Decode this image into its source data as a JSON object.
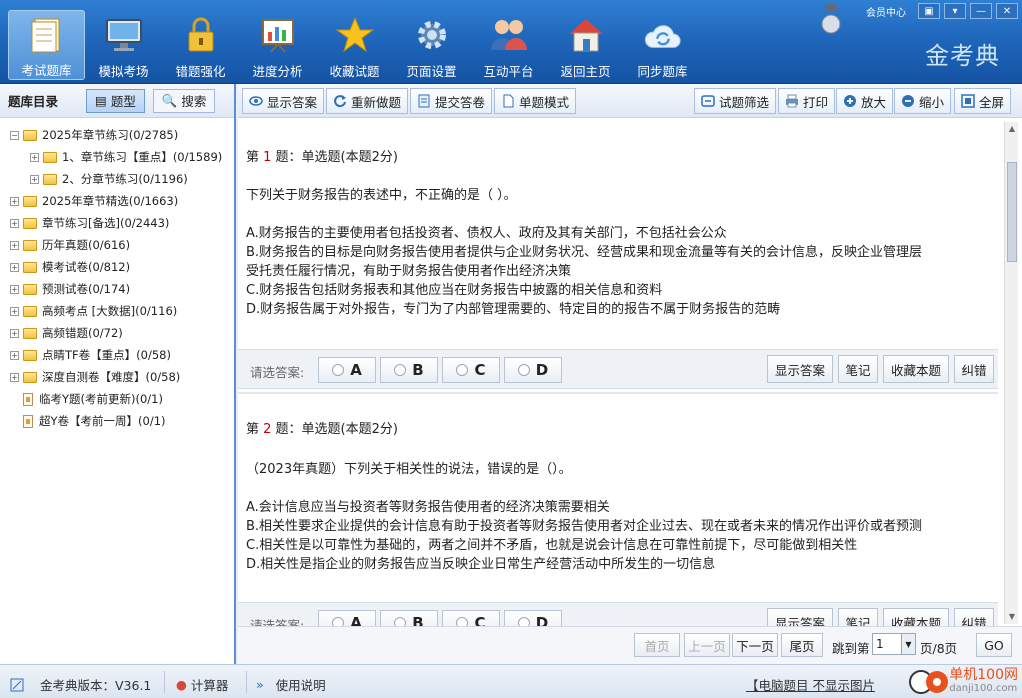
{
  "window": {
    "member_center": "会员中心",
    "brand": "金考典"
  },
  "nav": [
    {
      "label": "考试题库",
      "icon": "exam-bank-icon",
      "active": true
    },
    {
      "label": "模拟考场",
      "icon": "monitor-icon"
    },
    {
      "label": "错题强化",
      "icon": "lock-icon"
    },
    {
      "label": "进度分析",
      "icon": "chart-board-icon"
    },
    {
      "label": "收藏试题",
      "icon": "star-icon"
    },
    {
      "label": "页面设置",
      "icon": "gear-icon"
    },
    {
      "label": "互动平台",
      "icon": "users-icon"
    },
    {
      "label": "返回主页",
      "icon": "home-icon"
    },
    {
      "label": "同步题库",
      "icon": "cloud-sync-icon"
    }
  ],
  "left": {
    "title": "题库目录",
    "tab_type": "题型",
    "tab_search": "搜索",
    "tree": [
      {
        "label": "2025年章节练习(0/2785)",
        "level": 0,
        "expanded": true,
        "kind": "folder"
      },
      {
        "label": "1、章节练习【重点】(0/1589)",
        "level": 1,
        "kind": "folder"
      },
      {
        "label": "2、分章节练习(0/1196)",
        "level": 1,
        "kind": "folder"
      },
      {
        "label": "2025年章节精选(0/1663)",
        "level": 0,
        "kind": "folder"
      },
      {
        "label": "章节练习[备选](0/2443)",
        "level": 0,
        "kind": "folder"
      },
      {
        "label": "历年真题(0/616)",
        "level": 0,
        "kind": "folder"
      },
      {
        "label": "模考试卷(0/812)",
        "level": 0,
        "kind": "folder"
      },
      {
        "label": "预测试卷(0/174)",
        "level": 0,
        "kind": "folder"
      },
      {
        "label": "高频考点 [大数据](0/116)",
        "level": 0,
        "kind": "folder"
      },
      {
        "label": "高频错题(0/72)",
        "level": 0,
        "kind": "folder"
      },
      {
        "label": "点睛TF卷【重点】(0/58)",
        "level": 0,
        "kind": "folder"
      },
      {
        "label": "深度自测卷【难度】(0/58)",
        "level": 0,
        "kind": "folder"
      },
      {
        "label": "临考Y题(考前更新)(0/1)",
        "level": 0,
        "kind": "doc"
      },
      {
        "label": "超Y卷【考前一周】(0/1)",
        "level": 0,
        "kind": "doc"
      }
    ]
  },
  "toolbar": {
    "show_answer": "显示答案",
    "redo": "重新做题",
    "submit": "提交答卷",
    "single_mode": "单题模式",
    "filter": "试题筛选",
    "print": "打印",
    "zoom_in": "放大",
    "zoom_out": "缩小",
    "fullscreen": "全屏"
  },
  "questions": [
    {
      "prefix": "第 ",
      "number": "1",
      "suffix": " 题：单选题(本题2分)",
      "stem": "下列关于财务报告的表述中，不正确的是（ ）。",
      "options": [
        "A.财务报告的主要使用者包括投资者、债权人、政府及其有关部门，不包括社会公众",
        "B.财务报告的目标是向财务报告使用者提供与企业财务状况、经营成果和现金流量等有关的会计信息，反映企业管理层",
        "受托责任履行情况，有助于财务报告使用者作出经济决策",
        "C.财务报告包括财务报表和其他应当在财务报告中披露的相关信息和资料",
        "D.财务报告属于对外报告，专门为了内部管理需要的、特定目的的报告不属于财务报告的范畴"
      ]
    },
    {
      "prefix": "第 ",
      "number": "2",
      "suffix": " 题：单选题(本题2分)",
      "stem": "（2023年真题）下列关于相关性的说法，错误的是（）。",
      "options": [
        "A.会计信息应当与投资者等财务报告使用者的经济决策需要相关",
        "B.相关性要求企业提供的会计信息有助于投资者等财务报告使用者对企业过去、现在或者未来的情况作出评价或者预测",
        "C.相关性是以可靠性为基础的，两者之间并不矛盾，也就是说会计信息在可靠性前提下，尽可能做到相关性",
        "D.相关性是指企业的财务报告应当反映企业日常生产经营活动中所发生的一切信息"
      ]
    }
  ],
  "answer_bar": {
    "label": "请选答案:",
    "choices": [
      "A",
      "B",
      "C",
      "D"
    ],
    "show_answer": "显示答案",
    "notes": "笔记",
    "favorite": "收藏本题",
    "report": "纠错"
  },
  "pager": {
    "first": "首页",
    "prev": "上一页",
    "next": "下一页",
    "last": "尾页",
    "goto_label": "跳到第",
    "page_value": "1",
    "total": "页/8页",
    "go": "GO"
  },
  "status": {
    "version": "金考典版本：V36.1",
    "calculator": "计算器",
    "manual": "使用说明",
    "notice": "【电脑题目 不显示图片",
    "watermark_site": "单机100网",
    "watermark_url": "danji100.com"
  }
}
